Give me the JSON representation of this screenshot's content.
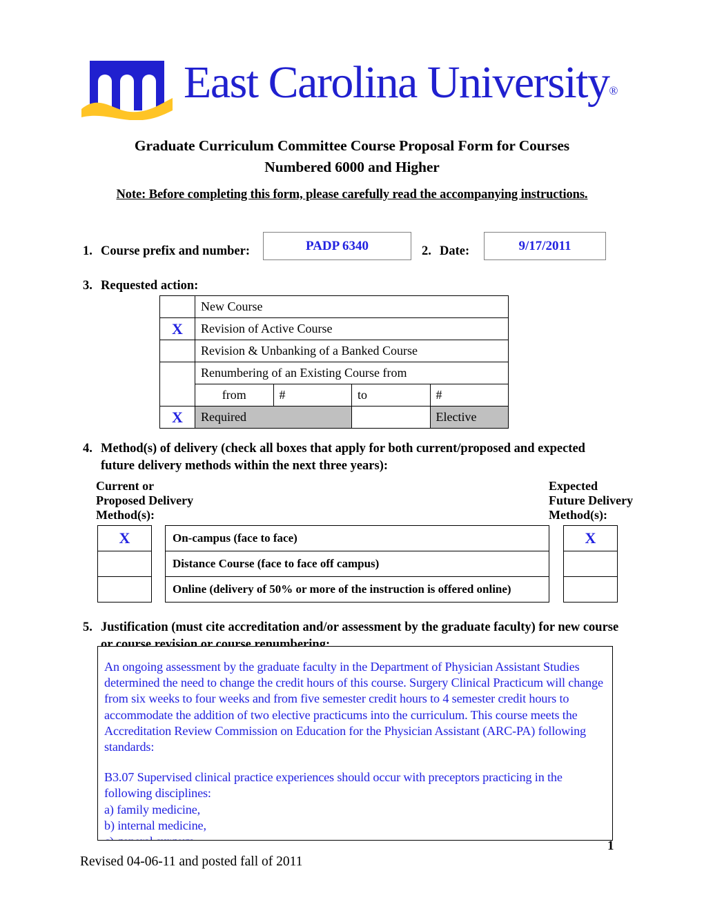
{
  "logo": {
    "icon": "ecu-cupola-logo",
    "wordmark": "East Carolina University",
    "registered_mark": "®",
    "blue": "#2020cf",
    "gold": "#ffc425"
  },
  "header": {
    "title_line1": "Graduate Curriculum Committee Course Proposal Form for Courses",
    "title_line2": "Numbered 6000 and Higher",
    "note": "Note: Before completing this form, please carefully read the accompanying instructions."
  },
  "section1": {
    "number": "1.",
    "label": "Course prefix and number:",
    "value": "PADP 6340",
    "placeholder": ""
  },
  "section2": {
    "number": "2.",
    "label": "Date:",
    "value": "9/17/2011",
    "placeholder": ""
  },
  "section3": {
    "number": "3.",
    "label": "Requested action:",
    "rows": [
      {
        "mark": "",
        "label": "New Course"
      },
      {
        "mark": "X",
        "label": "Revision of Active Course"
      },
      {
        "mark": "",
        "label": "Revision & Unbanking of a Banked Course"
      },
      {
        "mark": "",
        "label": "Renumbering of an Existing Course from"
      }
    ],
    "renumber": {
      "mark": "",
      "from_label": "from",
      "from_value": "#",
      "to_label": "to",
      "to_value": "#"
    },
    "required_elective": {
      "mark": "X",
      "required_label": "Required",
      "elective_mark": "",
      "elective_label": "Elective"
    }
  },
  "section4": {
    "number": "4.",
    "label_line1": "Method(s) of delivery (check all boxes that apply for both current/proposed and expected",
    "label_line2": "future delivery methods within the next three years):",
    "left_heading": [
      "Current or",
      "Proposed Delivery",
      "Method(s):"
    ],
    "right_heading": [
      "Expected",
      "Future Delivery",
      "Method(s):"
    ],
    "methods": [
      {
        "current_mark": "X",
        "label": "On-campus (face to face)",
        "future_mark": "X"
      },
      {
        "current_mark": "",
        "label": "Distance Course (face to face off campus)",
        "future_mark": ""
      },
      {
        "current_mark": "",
        "label": "Online (delivery of 50% or more of the instruction is offered online)",
        "future_mark": ""
      }
    ]
  },
  "section5": {
    "number": "5.",
    "label_line1": "Justification (must cite accreditation and/or assessment by the graduate faculty) for new course",
    "label_line2": "or course revision or course renumbering:",
    "body": {
      "paragraph1": "An ongoing assessment by the graduate faculty in the Department of Physician Assistant Studies determined the need to change the credit hours of this course.  Surgery Clinical Practicum will change from six weeks to four weeks and from five semester credit hours to 4 semester credit hours to accommodate the addition of two elective practicums into the curriculum.  This course meets the Accreditation Review Commission on Education for the Physician Assistant (ARC-PA) following standards:",
      "paragraph2": "B3.07 Supervised clinical practice experiences should occur with preceptors practicing in the following disciplines:",
      "item_a": "a) family medicine,",
      "item_b": "b) internal medicine,",
      "item_c": "c) general surgery,"
    }
  },
  "footer": {
    "page_number": "1",
    "revision_note": "Revised 04-06-11 and posted fall of 2011"
  }
}
